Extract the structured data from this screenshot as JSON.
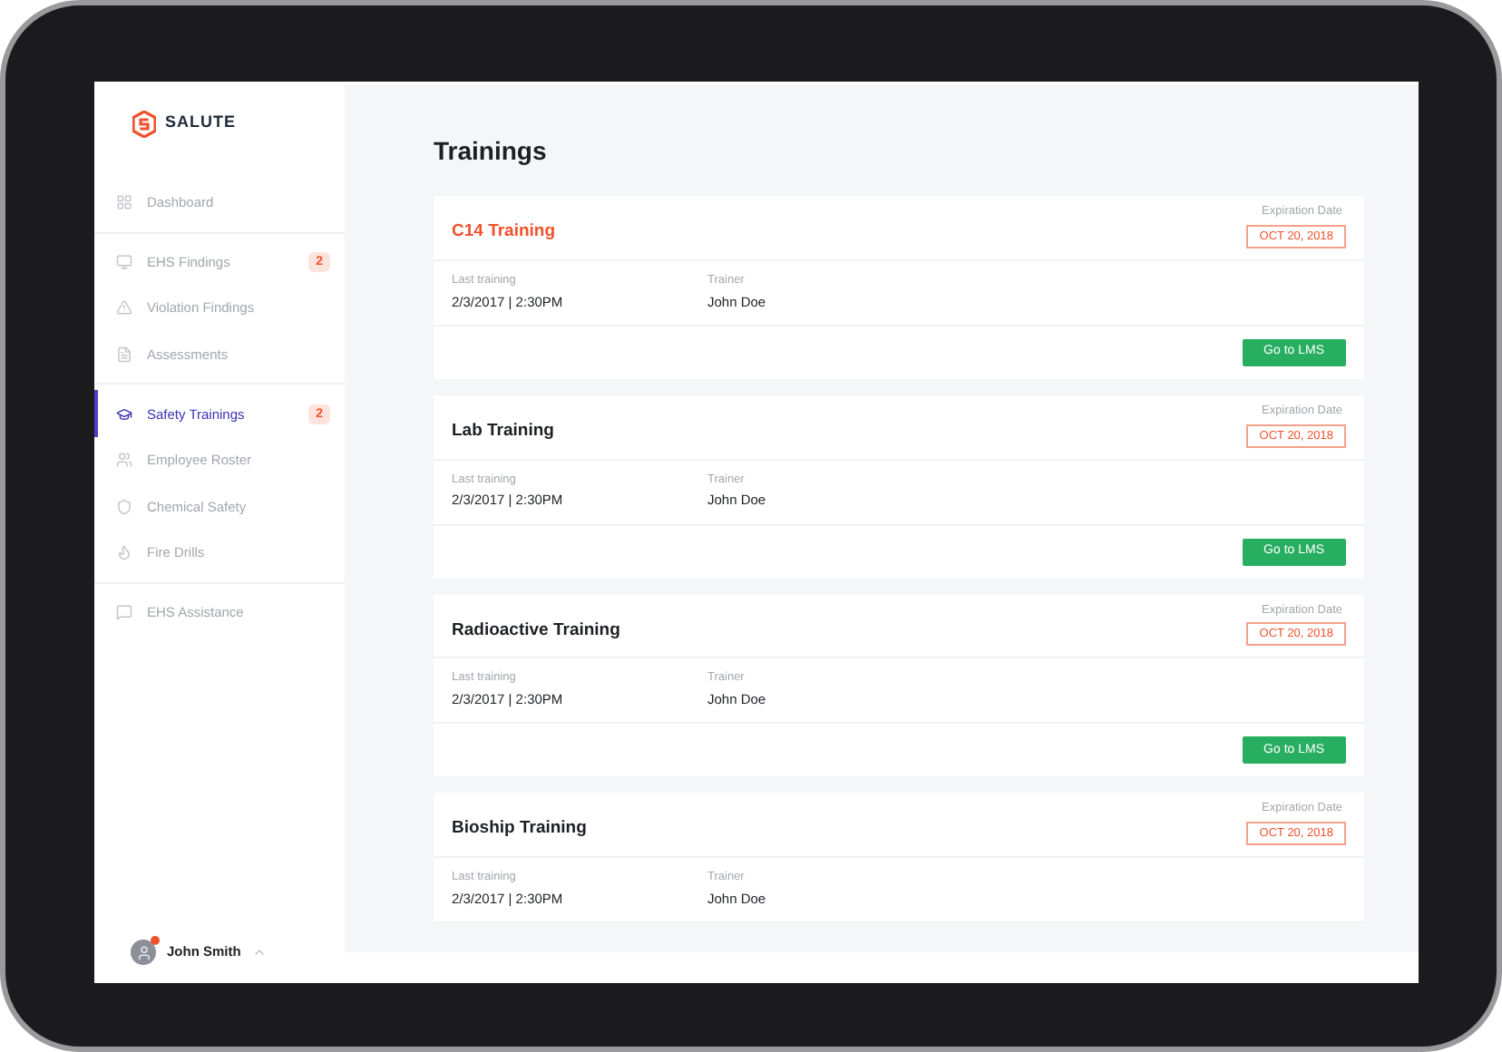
{
  "brand": {
    "name": "SALUTE"
  },
  "sidebar": {
    "sections": [
      [
        {
          "label": "Dashboard",
          "selected": false
        }
      ],
      [
        {
          "label": "EHS Findings",
          "selected": false,
          "badge": "2"
        },
        {
          "label": "Violation Findings",
          "selected": false
        },
        {
          "label": "Assessments",
          "selected": false
        }
      ],
      [
        {
          "label": "Safety Trainings",
          "selected": true,
          "badge": "2"
        },
        {
          "label": "Employee Roster",
          "selected": false
        },
        {
          "label": "Chemical Safety",
          "selected": false
        },
        {
          "label": "Fire Drills",
          "selected": false
        }
      ],
      [
        {
          "label": "EHS Assistance",
          "selected": false
        }
      ]
    ],
    "user": {
      "name": "John Smith",
      "notification": true
    }
  },
  "page": {
    "title": "Trainings"
  },
  "trainings": [
    {
      "name": "C14 Training",
      "highlighted": true,
      "expiration_label": "Expiration Date",
      "expiration": "OCT 20, 2018",
      "last_label": "Last training",
      "last": "2/3/2017 | 2:30PM",
      "trainer_label": "Trainer",
      "trainer": "John Doe",
      "button": "Go to LMS"
    },
    {
      "name": "Lab Training",
      "highlighted": false,
      "expiration_label": "Expiration Date",
      "expiration": "OCT 20, 2018",
      "last_label": "Last training",
      "last": "2/3/2017 | 2:30PM",
      "trainer_label": "Trainer",
      "trainer": "John Doe",
      "button": "Go to LMS"
    },
    {
      "name": "Radioactive Training",
      "highlighted": false,
      "expiration_label": "Expiration Date",
      "expiration": "OCT 20, 2018",
      "last_label": "Last training",
      "last": "2/3/2017 | 2:30PM",
      "trainer_label": "Trainer",
      "trainer": "John Doe",
      "button": "Go to LMS"
    },
    {
      "name": "Bioship Training",
      "highlighted": false,
      "expiration_label": "Expiration Date",
      "expiration": "OCT 20, 2018",
      "last_label": "Last training",
      "last": "2/3/2017 | 2:30PM",
      "trainer_label": "Trainer",
      "trainer": "John Doe"
    }
  ]
}
